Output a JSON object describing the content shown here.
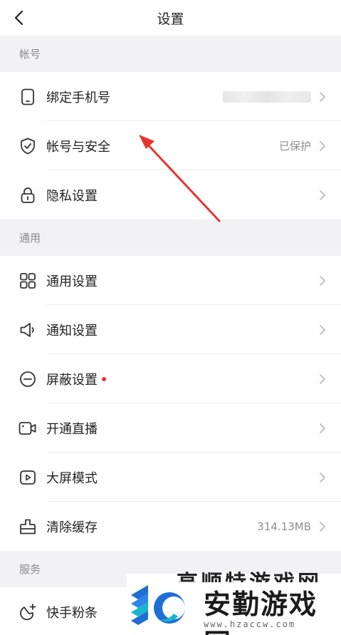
{
  "header": {
    "title": "设置"
  },
  "sections": [
    {
      "title": "帐号",
      "items": [
        {
          "icon": "phone-icon",
          "label": "绑定手机号",
          "value": "",
          "blurred": true
        },
        {
          "icon": "shield-icon",
          "label": "帐号与安全",
          "value": "已保护"
        },
        {
          "icon": "lock-icon",
          "label": "隐私设置",
          "value": ""
        }
      ]
    },
    {
      "title": "通用",
      "items": [
        {
          "icon": "grid-icon",
          "label": "通用设置",
          "value": ""
        },
        {
          "icon": "speaker-icon",
          "label": "通知设置",
          "value": ""
        },
        {
          "icon": "block-icon",
          "label": "屏蔽设置",
          "value": "",
          "badge": true
        },
        {
          "icon": "video-camera-icon",
          "label": "开通直播",
          "value": ""
        },
        {
          "icon": "play-screen-icon",
          "label": "大屏模式",
          "value": ""
        },
        {
          "icon": "clear-cache-icon",
          "label": "清除缓存",
          "value": "314.13MB"
        }
      ]
    },
    {
      "title": "服务",
      "items": [
        {
          "icon": "fan-tiao-icon",
          "label": "快手粉条",
          "value": ""
        }
      ]
    }
  ],
  "watermark": {
    "name": "安勤游戏网",
    "url": "www.hzaccw.com",
    "partial_text": "高顺特游戏网"
  },
  "colors": {
    "accent_red": "#f0303f",
    "annotation_arrow": "#e8332f",
    "section_bg": "#f2f2f4",
    "row_bg": "#ffffff",
    "watermark_blue": "#1d6fd6",
    "watermark_teal": "#17b6c8"
  }
}
